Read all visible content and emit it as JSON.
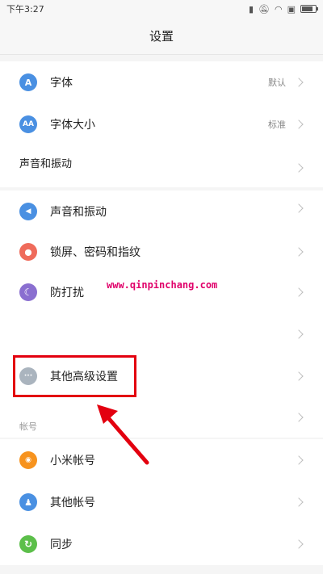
{
  "status_bar": {
    "time": "下午3:27",
    "icons": [
      "signal-icon",
      "mute-icon",
      "wifi-icon",
      "sim-icon",
      "battery-icon"
    ]
  },
  "header": {
    "title": "设置"
  },
  "rows": [
    {
      "name": "font",
      "label": "字体",
      "value": "默认",
      "icon": "font-icon",
      "icon_glyph": "A",
      "icon_color": "#4a90e2"
    },
    {
      "name": "font-size",
      "label": "字体大小",
      "value": "标准",
      "icon": "font-size-icon",
      "icon_glyph": "AA",
      "icon_color": "#4a90e2"
    },
    {
      "name": "sound-vibration-1",
      "label": "声音和振动"
    },
    {
      "name": "sound-vibration-2",
      "label": "声音和振动",
      "icon": "speaker-icon",
      "icon_glyph": "◀",
      "icon_color": "#4a90e2"
    },
    {
      "name": "lockscreen",
      "label": "锁屏、密码和指纹",
      "icon": "lock-icon",
      "icon_glyph": "⬤",
      "icon_color": "#ef6b5b"
    },
    {
      "name": "dnd",
      "label": "防打扰",
      "icon": "moon-icon",
      "icon_glyph": "☾",
      "icon_color": "#8a6fd0"
    },
    {
      "name": "blank"
    },
    {
      "name": "advanced",
      "label": "其他高级设置",
      "icon": "more-icon",
      "icon_glyph": "···",
      "icon_color": "#aab4be"
    },
    {
      "name": "xiaomi-account",
      "label": "小米帐号",
      "icon": "mi-account-icon",
      "icon_glyph": "◉",
      "icon_color": "#f7931e"
    },
    {
      "name": "other-account",
      "label": "其他帐号",
      "icon": "account-icon",
      "icon_glyph": "♟",
      "icon_color": "#4a90e2"
    },
    {
      "name": "sync",
      "label": "同步",
      "icon": "sync-icon",
      "icon_glyph": "↻",
      "icon_color": "#5cbf4a"
    }
  ],
  "section_account": "帐号",
  "watermark": "www.qinpinchang.com",
  "colors": {
    "highlight": "#e3000f"
  }
}
